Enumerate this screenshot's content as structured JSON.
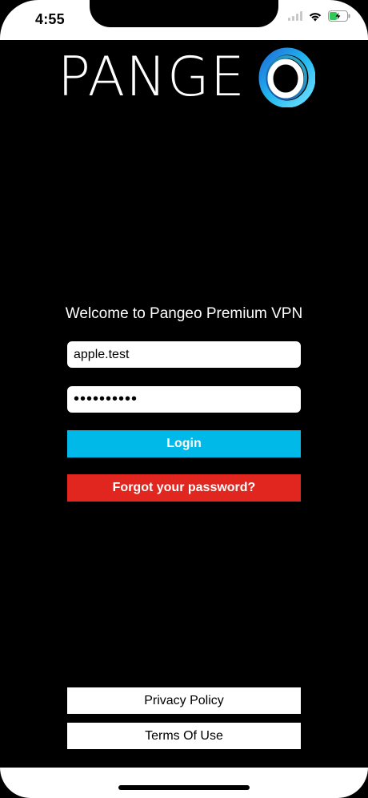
{
  "status_bar": {
    "time": "4:55"
  },
  "logo": {
    "text": "PANGE",
    "ring_icon": "pangeo-o-ring"
  },
  "welcome": {
    "text": "Welcome to Pangeo Premium VPN"
  },
  "form": {
    "username_value": "apple.test",
    "password_value": "••••••••••",
    "login_label": "Login",
    "forgot_label": "Forgot your password?"
  },
  "footer": {
    "privacy_label": "Privacy Policy",
    "terms_label": "Terms Of Use"
  },
  "colors": {
    "background": "#000000",
    "login_button": "#00b9e8",
    "forgot_button": "#e0261e",
    "field_background": "#ffffff"
  },
  "icons": {
    "signal": "cellular-signal-icon",
    "wifi": "wifi-icon",
    "battery": "battery-charging-icon"
  }
}
